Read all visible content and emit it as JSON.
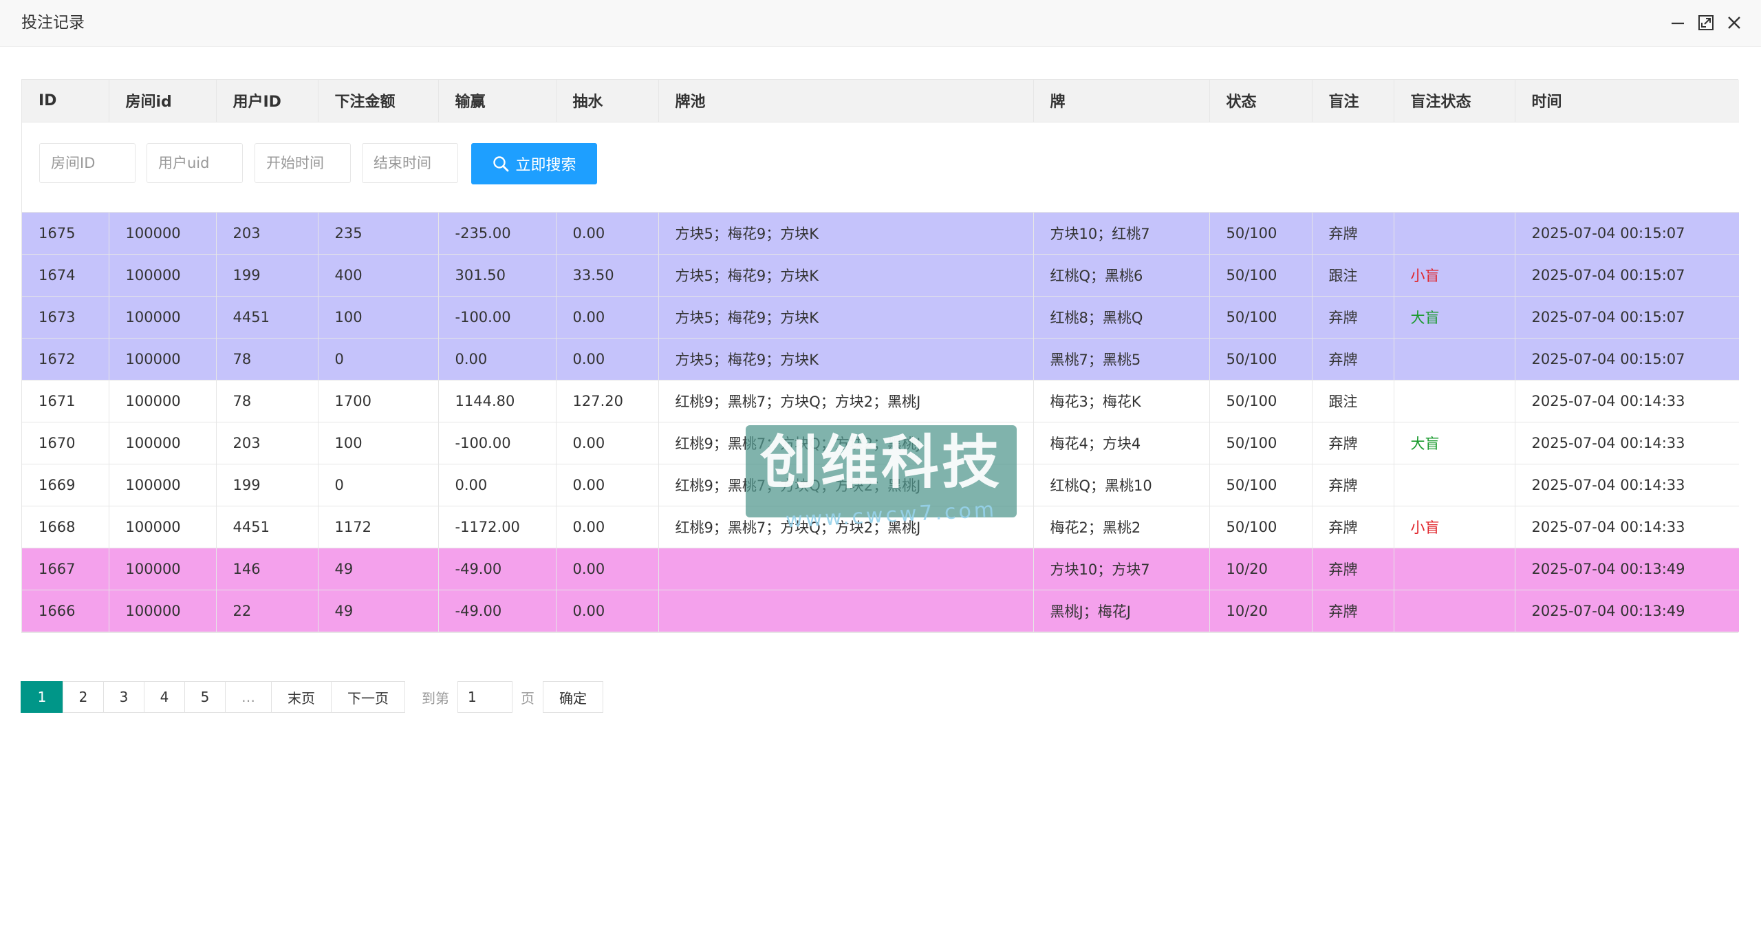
{
  "window": {
    "title": "投注记录",
    "controls": [
      "minimize-icon",
      "maximize-icon",
      "close-icon"
    ]
  },
  "table": {
    "columns": [
      "ID",
      "房间id",
      "用户ID",
      "下注金额",
      "输赢",
      "抽水",
      "牌池",
      "牌",
      "状态",
      "盲注",
      "盲注状态",
      "时间"
    ],
    "rows": [
      [
        "1675",
        "100000",
        "203",
        "235",
        "-235.00",
        "0.00",
        "方块5；梅花9；方块K",
        "方块10；红桃7",
        "50/100",
        "弃牌",
        "",
        "2025-07-04 00:15:07"
      ],
      [
        "1674",
        "100000",
        "199",
        "400",
        "301.50",
        "33.50",
        "方块5；梅花9；方块K",
        "红桃Q；黑桃6",
        "50/100",
        "跟注",
        "小盲",
        "2025-07-04 00:15:07"
      ],
      [
        "1673",
        "100000",
        "4451",
        "100",
        "-100.00",
        "0.00",
        "方块5；梅花9；方块K",
        "红桃8；黑桃Q",
        "50/100",
        "弃牌",
        "大盲",
        "2025-07-04 00:15:07"
      ],
      [
        "1672",
        "100000",
        "78",
        "0",
        "0.00",
        "0.00",
        "方块5；梅花9；方块K",
        "黑桃7；黑桃5",
        "50/100",
        "弃牌",
        "",
        "2025-07-04 00:15:07"
      ],
      [
        "1671",
        "100000",
        "78",
        "1700",
        "1144.80",
        "127.20",
        "红桃9；黑桃7；方块Q；方块2；黑桃J",
        "梅花3；梅花K",
        "50/100",
        "跟注",
        "",
        "2025-07-04 00:14:33"
      ],
      [
        "1670",
        "100000",
        "203",
        "100",
        "-100.00",
        "0.00",
        "红桃9；黑桃7；方块Q；方块2；黑桃J",
        "梅花4；方块4",
        "50/100",
        "弃牌",
        "大盲",
        "2025-07-04 00:14:33"
      ],
      [
        "1669",
        "100000",
        "199",
        "0",
        "0.00",
        "0.00",
        "红桃9；黑桃7；方块Q；方块2；黑桃J",
        "红桃Q；黑桃10",
        "50/100",
        "弃牌",
        "",
        "2025-07-04 00:14:33"
      ],
      [
        "1668",
        "100000",
        "4451",
        "1172",
        "-1172.00",
        "0.00",
        "红桃9；黑桃7；方块Q；方块2；黑桃J",
        "梅花2；黑桃2",
        "50/100",
        "弃牌",
        "小盲",
        "2025-07-04 00:14:33"
      ],
      [
        "1667",
        "100000",
        "146",
        "49",
        "-49.00",
        "0.00",
        "",
        "方块10；方块7",
        "10/20",
        "弃牌",
        "",
        "2025-07-04 00:13:49"
      ],
      [
        "1666",
        "100000",
        "22",
        "49",
        "-49.00",
        "0.00",
        "",
        "黑桃J；梅花J",
        "10/20",
        "弃牌",
        "",
        "2025-07-04 00:13:49"
      ]
    ],
    "row_colors": [
      "#c5c3fb",
      "#c5c3fb",
      "#c5c3fb",
      "#c5c3fb",
      "#ffffff",
      "#ffffff",
      "#ffffff",
      "#ffffff",
      "#f4a1ec",
      "#f4a1ec"
    ],
    "blind_colors": {
      "小盲": "#e0242a",
      "大盲": "#1a9a2e"
    }
  },
  "search": {
    "room_id_placeholder": "房间ID",
    "user_uid_placeholder": "用户uid",
    "start_time_placeholder": "开始时间",
    "end_time_placeholder": "结束时间",
    "button_label": "立即搜索",
    "button_color": "#1e9fff"
  },
  "pagination": {
    "pages": [
      "1",
      "2",
      "3",
      "4",
      "5"
    ],
    "current": "1",
    "ellipsis": "…",
    "last_label": "末页",
    "next_label": "下一页",
    "goto_label": "到第",
    "page_value": "1",
    "page_suffix": "页",
    "confirm_label": "确定",
    "active_color": "#009688"
  },
  "watermark": {
    "text": "创维科技",
    "url": "www.cwcw7.com"
  }
}
